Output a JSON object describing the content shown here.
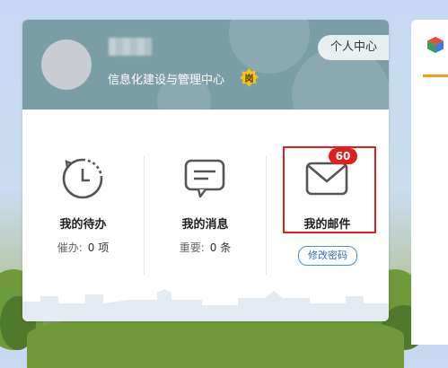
{
  "profile": {
    "department": "信息化建设与管理中心",
    "post_badge": "岗",
    "personal_center_label": "个人中心"
  },
  "todo": {
    "title": "我的待办",
    "sub_label": "催办:",
    "sub_value": "0 项"
  },
  "messages": {
    "title": "我的消息",
    "sub_label": "重要:",
    "sub_value": "0 条"
  },
  "mail": {
    "title": "我的邮件",
    "count": "60",
    "change_password_label": "修改密码"
  },
  "colors": {
    "header_bg": "#7a9ea5",
    "badge_red": "#e0201f",
    "link_blue": "#2f6fb8",
    "accent_orange": "#f0a020"
  }
}
